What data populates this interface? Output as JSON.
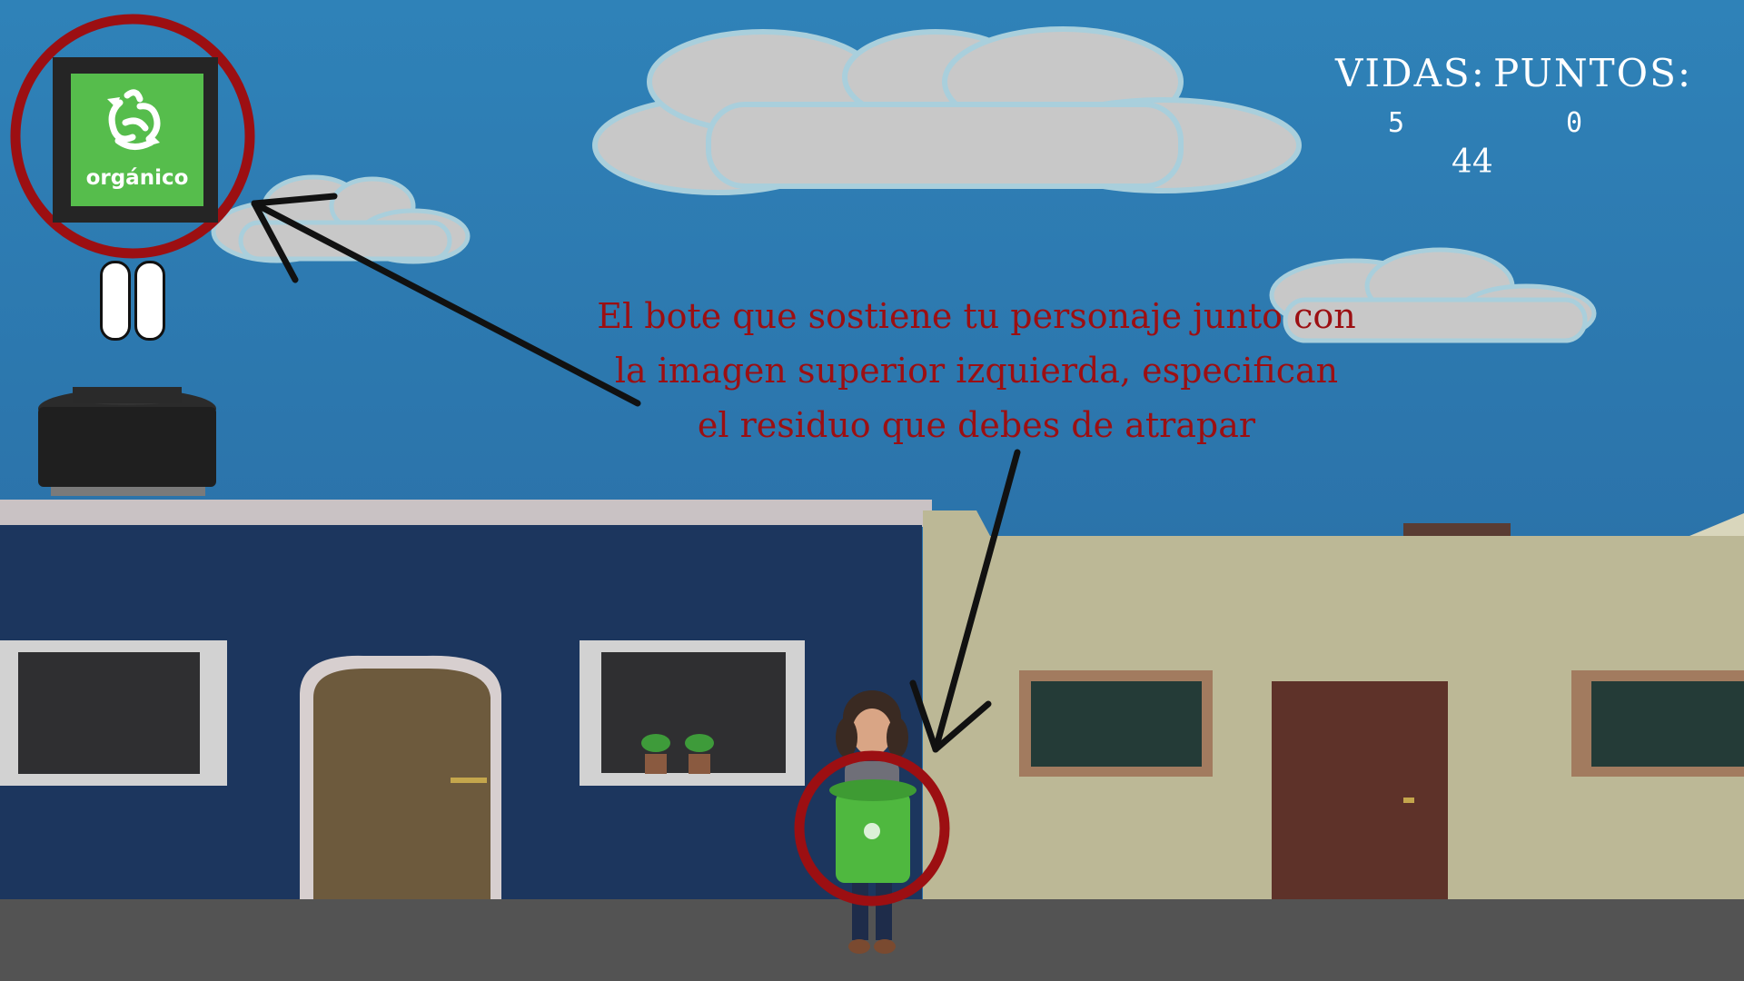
{
  "hud": {
    "lives_label": "VIDAS:",
    "points_label": "PUNTOS:",
    "lives_value": "5",
    "points_value": "0",
    "timer_value": "44"
  },
  "waste_card": {
    "label": "orgánico",
    "icon": "organic-recycle-icon",
    "color": "#56bd4c"
  },
  "pause": {
    "icon": "pause-icon"
  },
  "tutorial": {
    "hint_text": "El bote que sostiene tu personaje junto con\nla imagen superior izquierda, especifican\nel residuo que debes de atrapar",
    "highlight_color": "#9c0f12"
  }
}
